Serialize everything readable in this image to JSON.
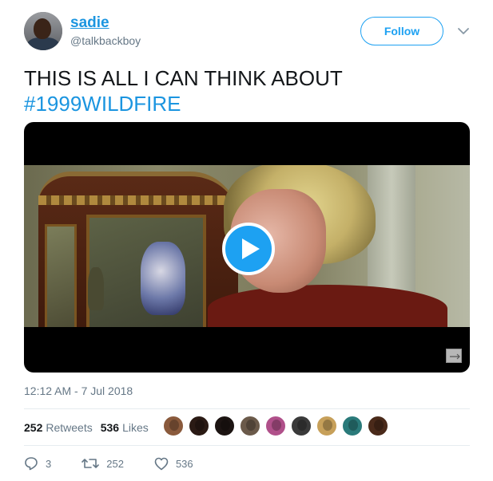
{
  "user": {
    "name": "sadie",
    "handle": "@talkbackboy"
  },
  "follow_label": "Follow",
  "tweet": {
    "text_line1": "THIS IS ALL I CAN THINK ABOUT",
    "hashtag": "#1999WILDFIRE",
    "timestamp": "12:12 AM - 7 Jul 2018"
  },
  "stats": {
    "retweets_count": "252",
    "retweets_label": "Retweets",
    "likes_count": "536",
    "likes_label": "Likes"
  },
  "likers": [
    {
      "color": "#8a5a3c"
    },
    {
      "color": "#2a1a14"
    },
    {
      "color": "#1c1412"
    },
    {
      "color": "#6b5a4a"
    },
    {
      "color": "#b0508a"
    },
    {
      "color": "#3a3a3a"
    },
    {
      "color": "#c7a05a"
    },
    {
      "color": "#2a7a7a"
    },
    {
      "color": "#4a2a1a"
    }
  ],
  "actions": {
    "reply_count": "3",
    "retweet_count": "252",
    "like_count": "536"
  },
  "colors": {
    "accent": "#1da1f2",
    "link": "#1b95e0",
    "muted": "#657786"
  },
  "icons": [
    "caret-down-icon",
    "play-icon",
    "expand-icon",
    "reply-icon",
    "retweet-icon",
    "heart-icon"
  ]
}
